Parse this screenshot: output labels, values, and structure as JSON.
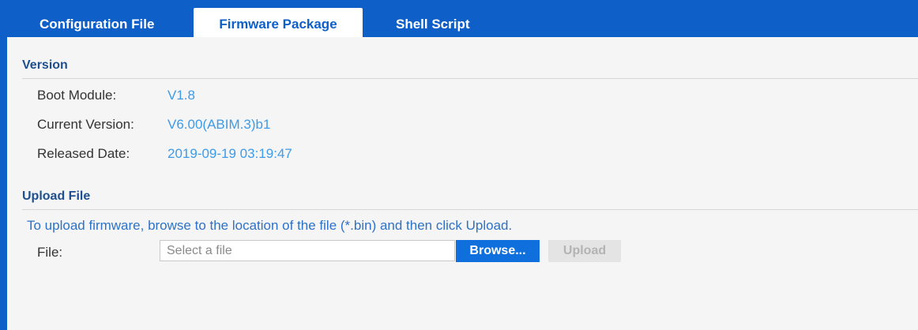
{
  "tabs": {
    "config": "Configuration File",
    "firmware": "Firmware Package",
    "shell": "Shell Script"
  },
  "version": {
    "title": "Version",
    "boot_module_label": "Boot Module:",
    "boot_module_value": "V1.8",
    "current_version_label": "Current Version:",
    "current_version_value": "V6.00(ABIM.3)b1",
    "released_date_label": "Released Date:",
    "released_date_value": "2019-09-19 03:19:47"
  },
  "upload": {
    "title": "Upload File",
    "hint": "To upload firmware, browse to the location of the file (*.bin) and then click Upload.",
    "file_label": "File:",
    "file_placeholder": "Select a file",
    "browse_label": "Browse...",
    "upload_label": "Upload"
  },
  "colors": {
    "brand_blue": "#0f5fc9",
    "value_blue": "#3d9be8",
    "disabled_gray": "#e4e4e4"
  }
}
